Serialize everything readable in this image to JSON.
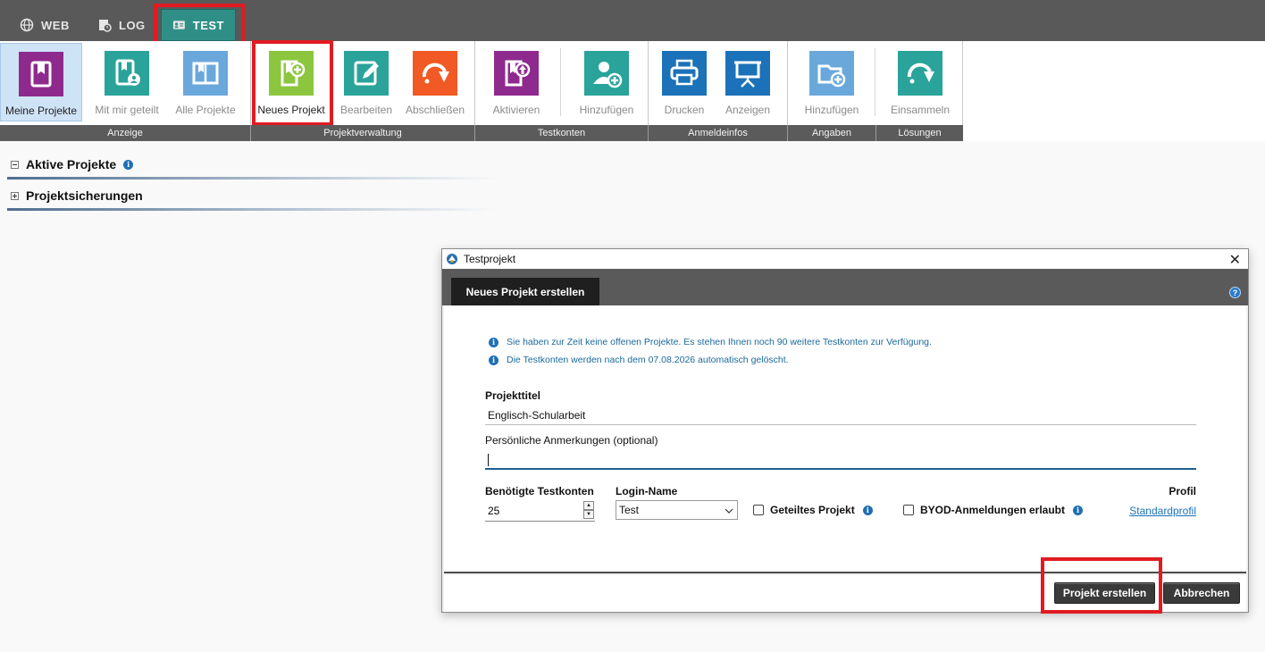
{
  "topbar": {
    "tabs": [
      {
        "label": "WEB",
        "icon": "globe-icon"
      },
      {
        "label": "LOG",
        "icon": "log-icon"
      },
      {
        "label": "TEST",
        "icon": "test-card-icon"
      }
    ]
  },
  "ribbon": {
    "buttons": [
      {
        "label": "Meine Projekte",
        "icon": "my-projects-icon",
        "color": "#8e2a8e"
      },
      {
        "label": "Mit mir geteilt",
        "icon": "shared-with-me-icon",
        "color": "#2aa39a"
      },
      {
        "label": "Alle Projekte",
        "icon": "all-projects-icon",
        "color": "#6aa8dc"
      },
      {
        "label": "Neues Projekt",
        "icon": "new-project-icon",
        "color": "#8cc63f"
      },
      {
        "label": "Bearbeiten",
        "icon": "edit-icon",
        "color": "#2aa39a"
      },
      {
        "label": "Abschließen",
        "icon": "finish-icon",
        "color": "#f15a24"
      },
      {
        "label": "Aktivieren",
        "icon": "activate-icon",
        "color": "#8e2a8e"
      },
      {
        "label": "Hinzufügen",
        "icon": "add-user-icon",
        "color": "#2aa39a"
      },
      {
        "label": "Drucken",
        "icon": "print-icon",
        "color": "#1b72b8"
      },
      {
        "label": "Anzeigen",
        "icon": "presentation-icon",
        "color": "#1b72b8"
      },
      {
        "label": "Hinzufügen",
        "icon": "add-folder-icon",
        "color": "#6aa8dc"
      },
      {
        "label": "Einsammeln",
        "icon": "collect-icon",
        "color": "#2aa39a"
      }
    ],
    "groups": [
      "Anzeige",
      "Projektverwaltung",
      "Testkonten",
      "Anmeldeinfos",
      "Angaben",
      "Lösungen"
    ]
  },
  "sections": {
    "active": "Aktive Projekte",
    "backups": "Projektsicherungen"
  },
  "dialog": {
    "window_title": "Testprojekt",
    "tab": "Neues Projekt erstellen",
    "messages": [
      "Sie haben zur Zeit keine offenen Projekte. Es stehen Ihnen noch 90 weitere Testkonten zur Verfügung.",
      "Die Testkonten werden nach dem 07.08.2026 automatisch gelöscht."
    ],
    "title_label": "Projekttitel",
    "title_value": "Englisch-Schularbeit",
    "notes_label": "Persönliche Anmerkungen (optional)",
    "notes_value": "",
    "accounts_label": "Benötigte Testkonten",
    "accounts_value": "25",
    "login_label": "Login-Name",
    "login_value": "Test",
    "shared_label": "Geteiltes Projekt",
    "byod_label": "BYOD-Anmeldungen erlaubt",
    "profile_label": "Profil",
    "profile_link": "Standardprofil",
    "create_button": "Projekt erstellen",
    "cancel_button": "Abbrechen"
  },
  "colors": {
    "highlight": "#e11b22",
    "active_tab": "#2f8f86",
    "accent": "#1f6fb5"
  }
}
